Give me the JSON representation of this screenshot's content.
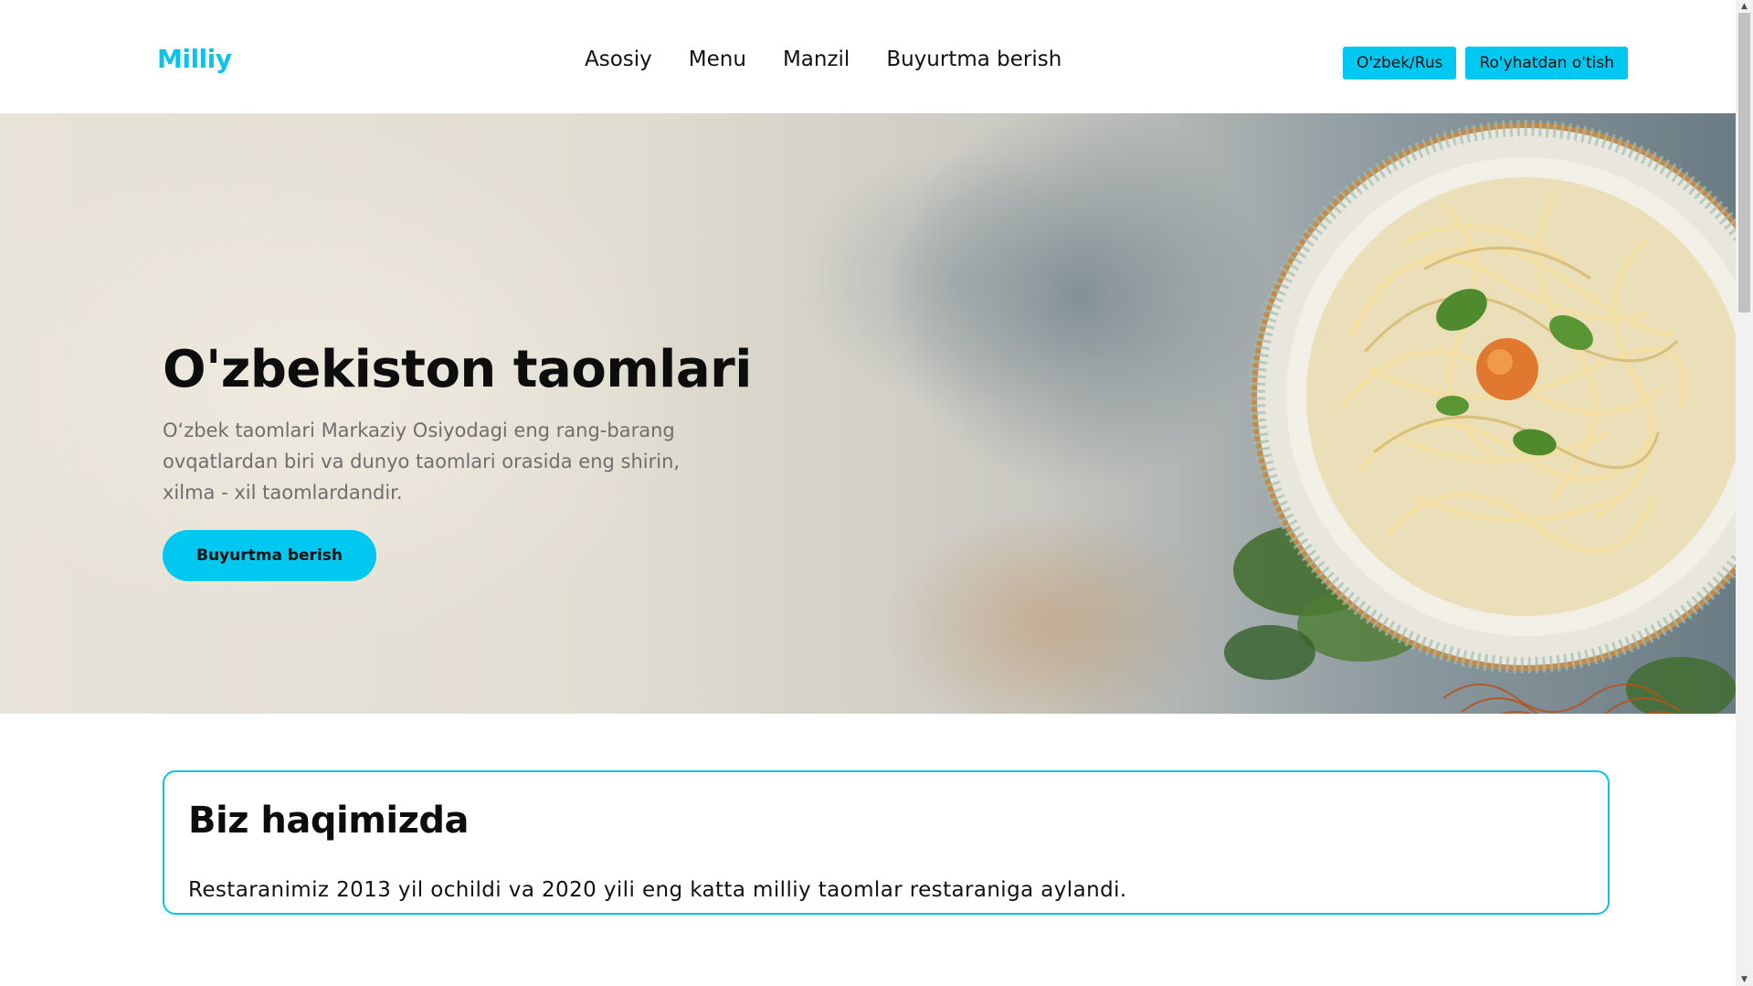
{
  "header": {
    "logo": "Milliy",
    "nav": [
      "Asosiy",
      "Menu",
      "Manzil",
      "Buyurtma berish"
    ],
    "language_button": "O'zbek/Rus",
    "register_button": "Ro'yhatdan o'tish"
  },
  "hero": {
    "title": "O'zbekiston taomlari",
    "description": "O‘zbek taomlari Markaziy Osiyodagi eng rang-barang ovqatlardan biri va dunyo taomlari orasida eng shirin, xilma - xil taomlardandir.",
    "cta_label": "Buyurtma berish",
    "image": "noodle-soup-bowl"
  },
  "about": {
    "heading": "Biz haqimizda",
    "text": "Restaranimiz 2013 yil ochildi va 2020 yili eng katta milliy taomlar restaraniga aylandi."
  },
  "colors": {
    "accent": "#00c8f0",
    "text": "#111111",
    "muted": "#6e6e6e"
  }
}
